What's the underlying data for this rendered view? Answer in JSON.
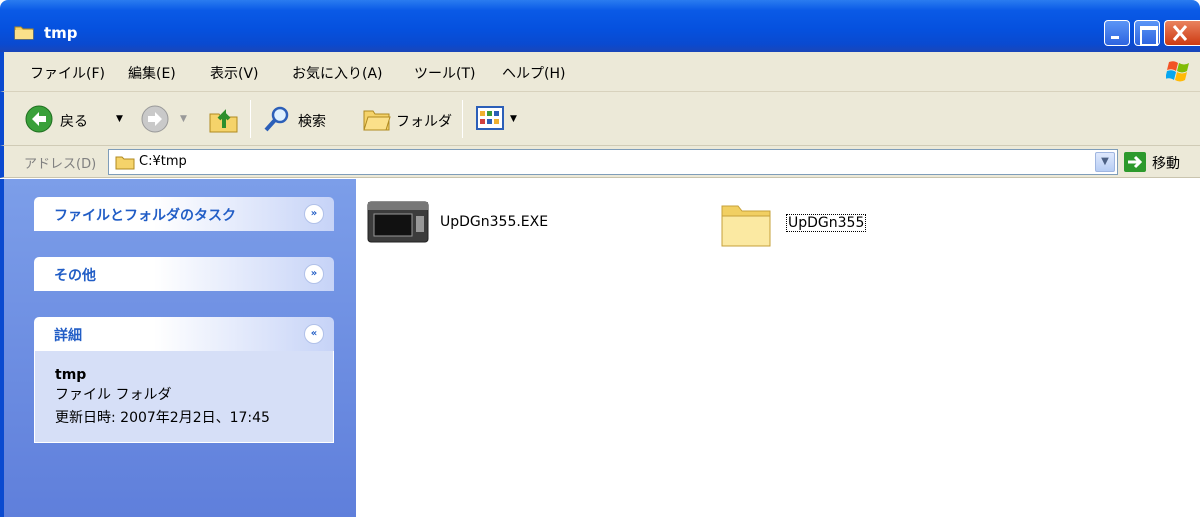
{
  "window": {
    "title": "tmp"
  },
  "menu": [
    {
      "label": "ファイル(F)"
    },
    {
      "label": "編集(E)"
    },
    {
      "label": "表示(V)"
    },
    {
      "label": "お気に入り(A)"
    },
    {
      "label": "ツール(T)"
    },
    {
      "label": "ヘルプ(H)"
    }
  ],
  "toolbar": {
    "back_label": "戻る",
    "search_label": "検索",
    "folders_label": "フォルダ"
  },
  "address": {
    "label": "アドレス(D)",
    "value": "C:¥tmp",
    "go_label": "移動"
  },
  "taskpane": {
    "file_tasks_title": "ファイルとフォルダのタスク",
    "other_title": "その他",
    "details_title": "詳細",
    "details": {
      "name": "tmp",
      "type": "ファイル フォルダ",
      "modified": "更新日時: 2007年2月2日、17:45"
    }
  },
  "files": [
    {
      "name": "UpDGn355.EXE",
      "icon": "executable-icon"
    },
    {
      "name": "UpDGn355",
      "icon": "folder-icon",
      "selected": true
    }
  ]
}
